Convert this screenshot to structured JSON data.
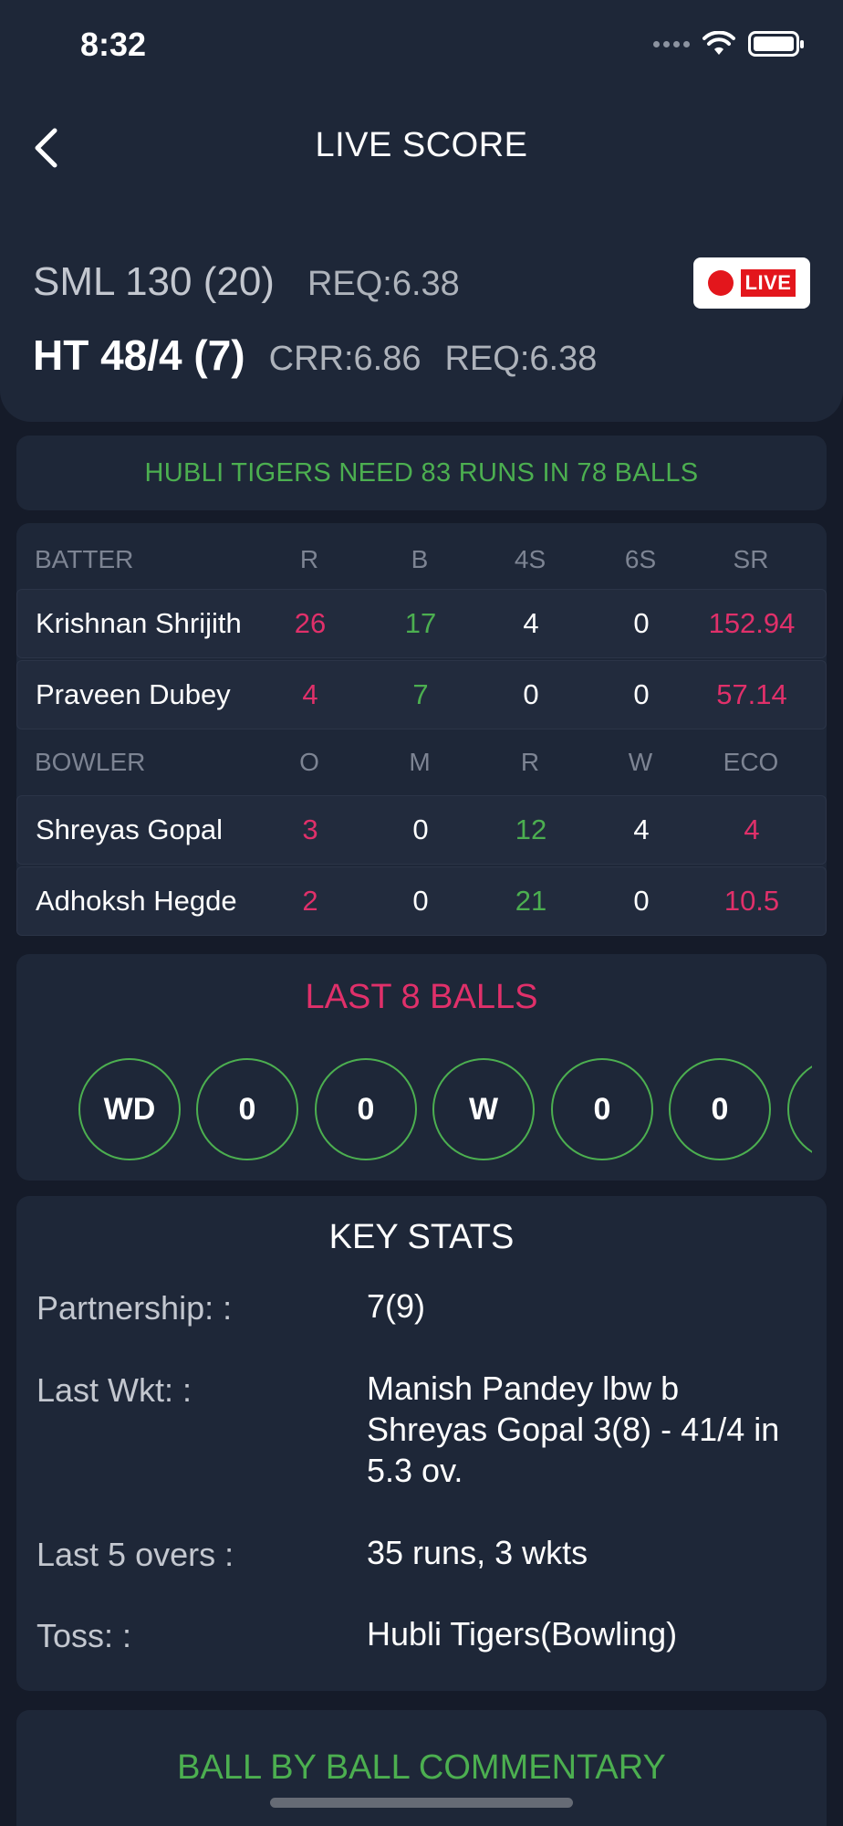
{
  "status_bar": {
    "time": "8:32"
  },
  "header": {
    "title": "LIVE SCORE"
  },
  "score": {
    "team1": "SML 130 (20)",
    "team1_req": "REQ:6.38",
    "team2": "HT 48/4 (7)",
    "team2_crr": "CRR:6.86",
    "team2_req": "REQ:6.38",
    "live_badge": "LIVE"
  },
  "need_message": "HUBLI TIGERS NEED 83 RUNS IN 78 BALLS",
  "batting": {
    "headers": [
      "BATTER",
      "R",
      "B",
      "4S",
      "6S",
      "SR"
    ],
    "rows": [
      {
        "name": "Krishnan Shrijith",
        "r": "26",
        "b": "17",
        "fours": "4",
        "sixes": "0",
        "sr": "152.94"
      },
      {
        "name": "Praveen Dubey",
        "r": "4",
        "b": "7",
        "fours": "0",
        "sixes": "0",
        "sr": "57.14"
      }
    ]
  },
  "bowling": {
    "headers": [
      "BOWLER",
      "O",
      "M",
      "R",
      "W",
      "ECO"
    ],
    "rows": [
      {
        "name": "Shreyas Gopal",
        "o": "3",
        "m": "0",
        "r": "12",
        "w": "4",
        "eco": "4"
      },
      {
        "name": "Adhoksh Hegde",
        "o": "2",
        "m": "0",
        "r": "21",
        "w": "0",
        "eco": "10.5"
      }
    ]
  },
  "last_balls": {
    "title": "LAST 8 BALLS",
    "balls": [
      "WD",
      "0",
      "0",
      "W",
      "0",
      "0",
      ""
    ]
  },
  "key_stats": {
    "title": "KEY STATS",
    "items": [
      {
        "label": "Partnership:  :",
        "value": "7(9)"
      },
      {
        "label": "Last Wkt:  :",
        "value": "Manish Pandey lbw b Shreyas Gopal 3(8) - 41/4 in 5.3 ov."
      },
      {
        "label": "Last 5 overs  :",
        "value": "35 runs, 3 wkts"
      },
      {
        "label": "Toss:  :",
        "value": "Hubli Tigers(Bowling)"
      }
    ]
  },
  "commentary": {
    "title": "BALL BY BALL COMMENTARY"
  },
  "colors": {
    "background": "#151b29",
    "card": "#1e2738",
    "pink": "#e0306a",
    "green": "#4caf50",
    "live_red": "#e3161c"
  }
}
